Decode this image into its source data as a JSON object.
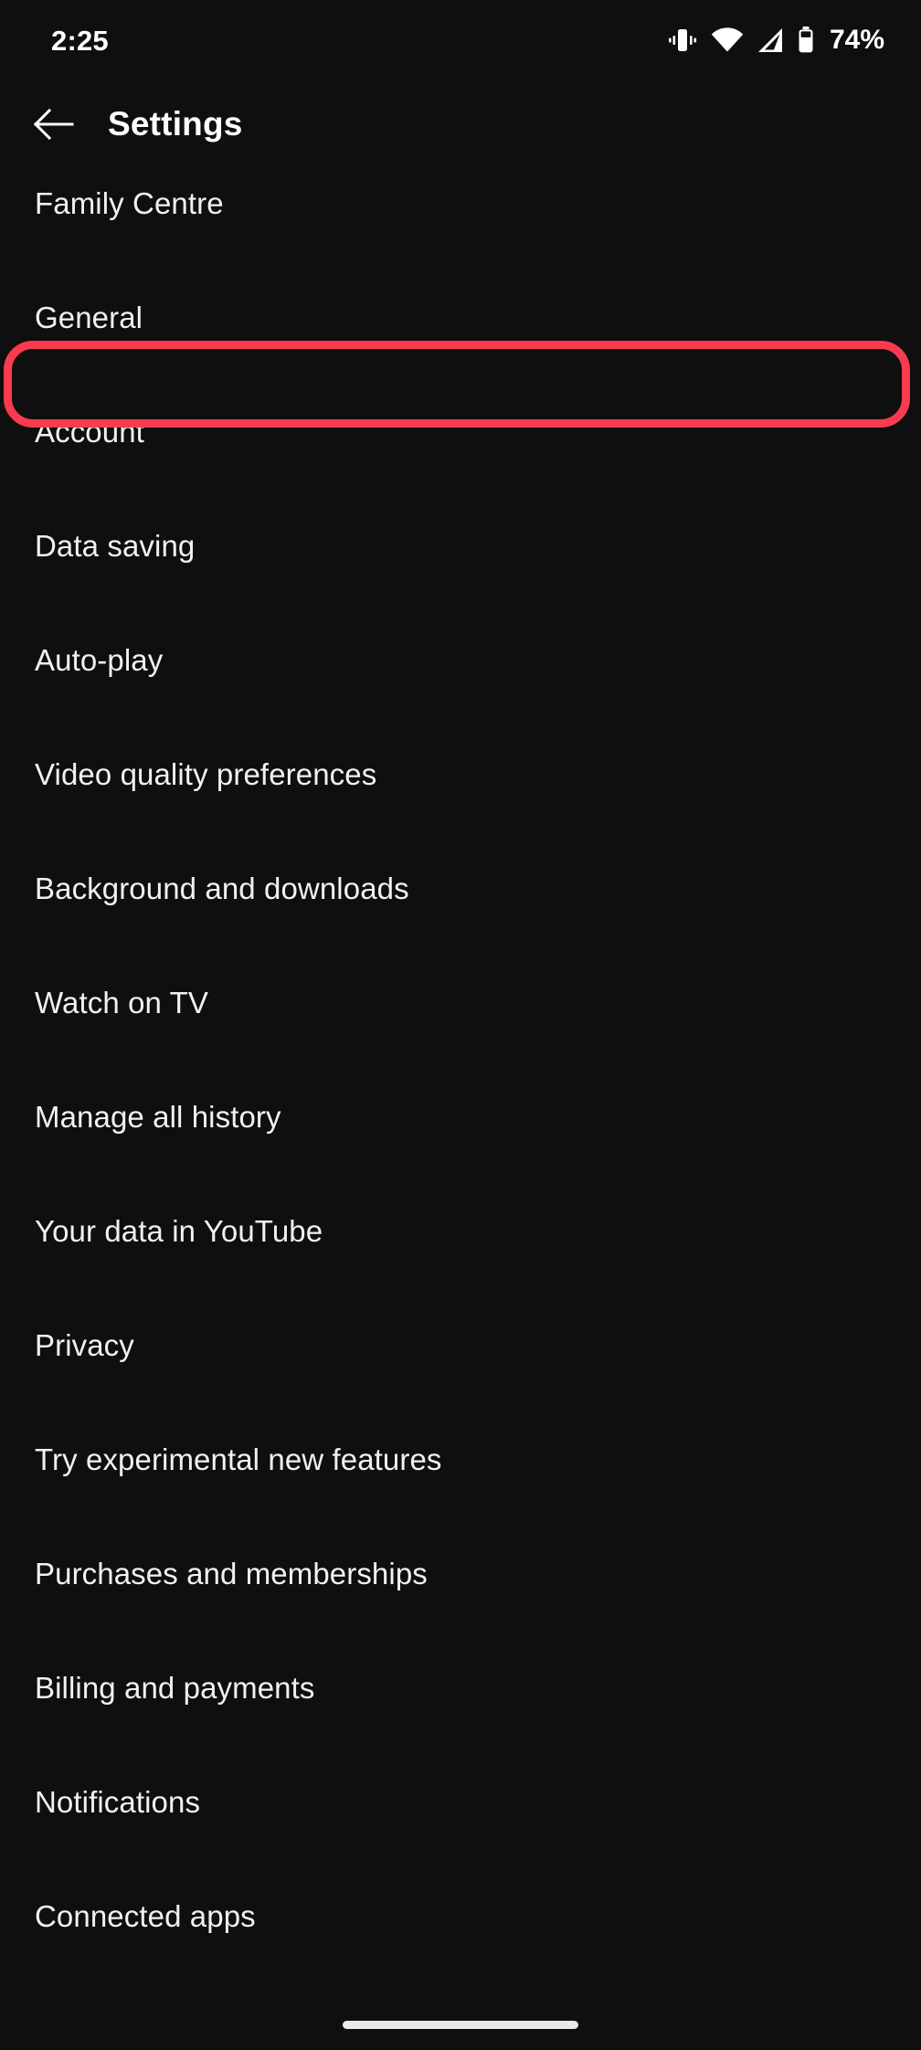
{
  "status_bar": {
    "time": "2:25",
    "battery_percent": "74%",
    "icons": [
      "vibrate-icon",
      "wifi-icon",
      "cellular-signal-icon",
      "battery-icon"
    ]
  },
  "app_bar": {
    "back_icon": "back-arrow-icon",
    "title": "Settings"
  },
  "settings": {
    "items": [
      {
        "label": "Family Centre"
      },
      {
        "label": "General"
      },
      {
        "label": "Account"
      },
      {
        "label": "Data saving"
      },
      {
        "label": "Auto-play"
      },
      {
        "label": "Video quality preferences"
      },
      {
        "label": "Background and downloads"
      },
      {
        "label": "Watch on TV"
      },
      {
        "label": "Manage all history"
      },
      {
        "label": "Your data in YouTube"
      },
      {
        "label": "Privacy"
      },
      {
        "label": "Try experimental new features"
      },
      {
        "label": "Purchases and memberships"
      },
      {
        "label": "Billing and payments"
      },
      {
        "label": "Notifications"
      },
      {
        "label": "Connected apps"
      }
    ]
  },
  "annotation": {
    "highlighted_item": "General",
    "color": "#fa3b4f"
  },
  "theme": {
    "background": "#0f0f0f",
    "text": "#f1f1f1"
  }
}
